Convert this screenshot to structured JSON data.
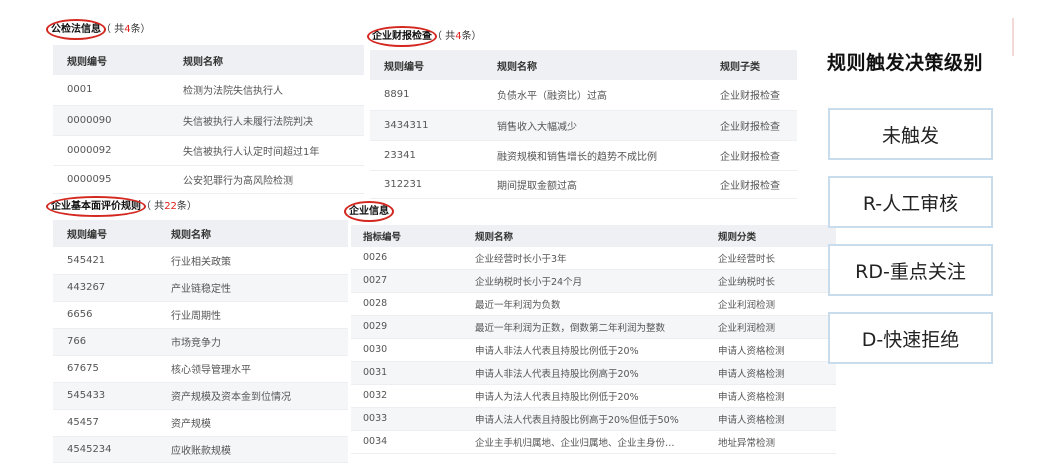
{
  "panels": {
    "court": {
      "title": "公检法信息",
      "count_prefix": "（ 共",
      "count": "4",
      "count_suffix": "条）",
      "headers": [
        "规则编号",
        "规则名称"
      ],
      "rows": [
        [
          "0001",
          "检测为法院失信执行人"
        ],
        [
          "0000090",
          "失信被执行人未履行法院判决"
        ],
        [
          "0000092",
          "失信被执行人认定时间超过1年"
        ],
        [
          "0000095",
          "公安犯罪行为高风险检测"
        ]
      ]
    },
    "finance": {
      "title": "企业财报检查",
      "count_prefix": "（ 共",
      "count": "4",
      "count_suffix": "条）",
      "headers": [
        "规则编号",
        "规则名称",
        "规则子类"
      ],
      "rows": [
        [
          "8891",
          "负债水平（融资比）过高",
          "企业财报检查"
        ],
        [
          "3434311",
          "销售收入大幅减少",
          "企业财报检查"
        ],
        [
          "23341",
          "融资规模和销售增长的趋势不成比例",
          "企业财报检查"
        ],
        [
          "312231",
          "期间提取金额过高",
          "企业财报检查"
        ]
      ]
    },
    "basic": {
      "title": "企业基本面评价规则",
      "count_prefix": "（ 共",
      "count": "22",
      "count_suffix": "条）",
      "headers": [
        "规则编号",
        "规则名称"
      ],
      "rows": [
        [
          "545421",
          "行业相关政策"
        ],
        [
          "443267",
          "产业链稳定性"
        ],
        [
          "6656",
          "行业周期性"
        ],
        [
          "766",
          "市场竞争力"
        ],
        [
          "67675",
          "核心领导管理水平"
        ],
        [
          "545433",
          "资产规模及资本金到位情况"
        ],
        [
          "45457",
          "资产规模"
        ],
        [
          "4545234",
          "应收账款规模"
        ]
      ]
    },
    "company": {
      "title": "企业信息",
      "headers": [
        "指标编号",
        "规则名称",
        "规则分类"
      ],
      "rows": [
        [
          "0026",
          "企业经营时长小于3年",
          "企业经营时长"
        ],
        [
          "0027",
          "企业纳税时长小于24个月",
          "企业纳税时长"
        ],
        [
          "0028",
          "最近一年利润为负数",
          "企业利润检测"
        ],
        [
          "0029",
          "最近一年利润为正数，倒数第二年利润为整数",
          "企业利润检测"
        ],
        [
          "0030",
          "申请人非法人代表且持股比例低于20%",
          "申请人资格检测"
        ],
        [
          "0031",
          "申请人非法人代表且持股比例高于20%",
          "申请人资格检测"
        ],
        [
          "0032",
          "申请人为法人代表且持股比例低于20%",
          "申请人资格检测"
        ],
        [
          "0033",
          "申请人法人代表且持股比例高于20%但低于50%",
          "申请人资格检测"
        ],
        [
          "0034",
          "企业主手机归属地、企业归属地、企业主身份…",
          "地址异常检测"
        ]
      ]
    }
  },
  "decision": {
    "title": "规则触发决策级别",
    "levels": [
      "未触发",
      "R-人工审核",
      "RD-重点关注",
      "D-快速拒绝"
    ]
  },
  "colors": {
    "highlight_circle": "#d3271f",
    "count_red": "#e0231b",
    "box_border": "#c9dcec"
  }
}
